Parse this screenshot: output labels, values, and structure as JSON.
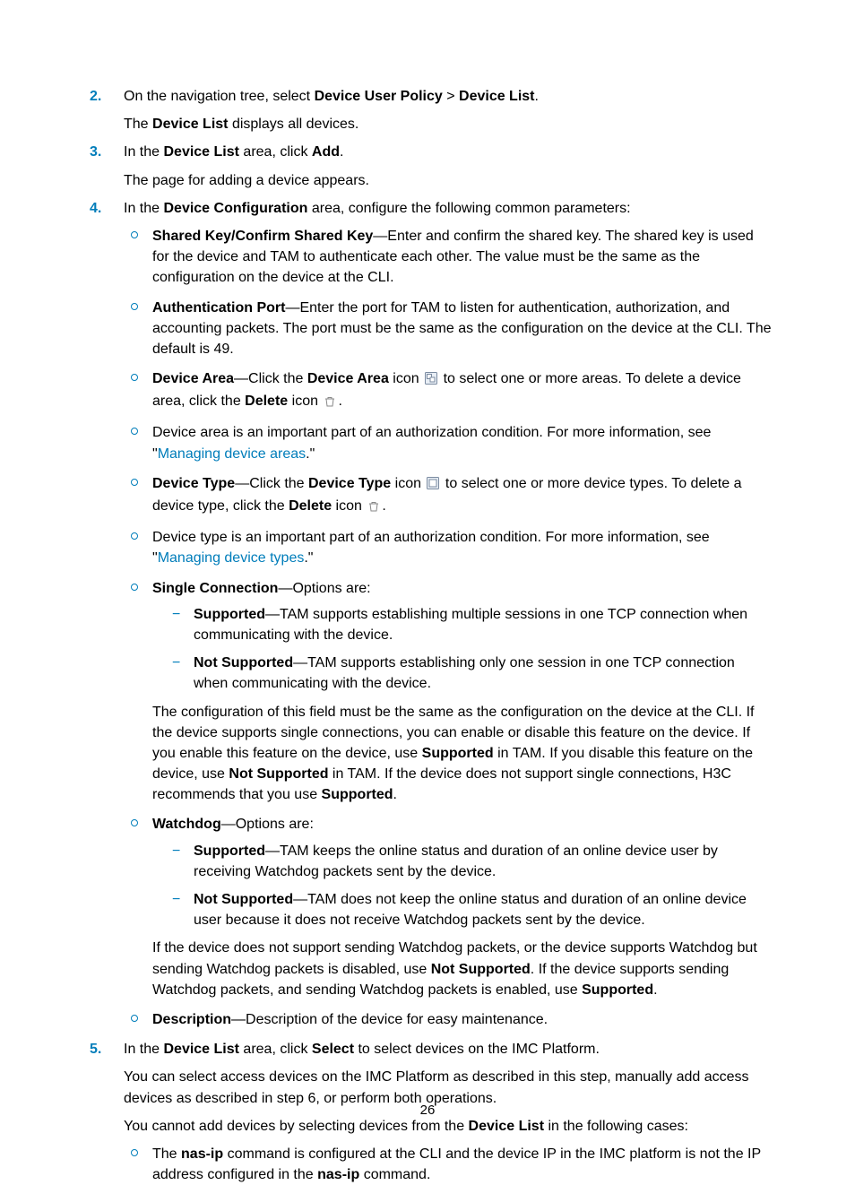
{
  "pageNumber": "26",
  "steps": {
    "s2": {
      "num": "2.",
      "line1_a": "On the navigation tree, select ",
      "line1_b": "Device User Policy",
      "line1_c": " > ",
      "line1_d": "Device List",
      "line1_e": ".",
      "line2_a": "The ",
      "line2_b": "Device List",
      "line2_c": " displays all devices."
    },
    "s3": {
      "num": "3.",
      "line1_a": "In the ",
      "line1_b": "Device List",
      "line1_c": " area, click ",
      "line1_d": "Add",
      "line1_e": ".",
      "line2": "The page for adding a device appears."
    },
    "s4": {
      "num": "4.",
      "intro_a": "In the ",
      "intro_b": "Device Configuration",
      "intro_c": " area, configure the following common parameters:",
      "b_sharedkey": {
        "label": "Shared Key/Confirm Shared Key",
        "rest": "—Enter and confirm the shared key. The shared key is used for the device and TAM to authenticate each other. The value must be the same as the configuration on the device at the CLI."
      },
      "b_authport": {
        "label": "Authentication Port",
        "rest": "—Enter the port for TAM to listen for authentication, authorization, and accounting packets. The port must be the same as the configuration on the device at the CLI. The default is 49."
      },
      "b_devicearea": {
        "label": "Device Area",
        "p1a": "—Click the ",
        "p1b": "Device Area",
        "p1c": " icon ",
        "p2a": " to select one or more areas. To delete a device area, click the ",
        "p2b": "Delete",
        "p2c": " icon ",
        "p2d": "."
      },
      "b_devicearea_note": {
        "pre": "Device area is an important part of an authorization condition. For more information, see \"",
        "link": "Managing device areas",
        "post": ".\""
      },
      "b_devicetype": {
        "label": "Device Type",
        "p1a": "—Click the ",
        "p1b": "Device Type",
        "p1c": " icon ",
        "p2a": " to select one or more device types. To delete a device type, click the ",
        "p2b": "Delete",
        "p2c": " icon ",
        "p2d": "."
      },
      "b_devicetype_note": {
        "pre": "Device type is an important part of an authorization condition. For more information, see \"",
        "link": "Managing device types",
        "post": ".\""
      },
      "b_singleconn": {
        "label": "Single Connection",
        "rest": "—Options are:",
        "d_supported": {
          "label": "Supported",
          "rest": "—TAM supports establishing multiple sessions in one TCP connection when communicating with the device."
        },
        "d_notsupported": {
          "label": "Not Supported",
          "rest": "—TAM supports establishing only one session in one TCP connection when communicating with the device."
        },
        "after_a": "The configuration of this field must be the same as the configuration on the device at the CLI. If the device supports single connections, you can enable or disable this feature on the device. If you enable this feature on the device, use ",
        "after_b": "Supported",
        "after_c": " in TAM. If you disable this feature on the device, use ",
        "after_d": "Not Supported",
        "after_e": " in TAM. If the device does not support single connections, H3C recommends that you use ",
        "after_f": "Supported",
        "after_g": "."
      },
      "b_watchdog": {
        "label": "Watchdog",
        "rest": "—Options are:",
        "d_supported": {
          "label": "Supported",
          "rest": "—TAM keeps the online status and duration of an online device user by receiving Watchdog packets sent by the device."
        },
        "d_notsupported": {
          "label": "Not Supported",
          "rest": "—TAM does not keep the online status and duration of an online device user because it does not receive Watchdog packets sent by the device."
        },
        "after_a": "If the device does not support sending Watchdog packets, or the device supports Watchdog but sending Watchdog packets is disabled, use ",
        "after_b": "Not Supported",
        "after_c": ". If the device supports sending Watchdog packets, and sending Watchdog packets is enabled, use ",
        "after_d": "Supported",
        "after_e": "."
      },
      "b_description": {
        "label": "Description",
        "rest": "—Description of the device for easy maintenance."
      }
    },
    "s5": {
      "num": "5.",
      "line1_a": "In the ",
      "line1_b": "Device List",
      "line1_c": " area, click ",
      "line1_d": "Select",
      "line1_e": " to select devices on the IMC Platform.",
      "line2": "You can select access devices on the IMC Platform as described in this step, manually add access devices as described in step 6, or perform both operations.",
      "line3_a": "You cannot add devices by selecting devices from the ",
      "line3_b": "Device List",
      "line3_c": " in the following cases:",
      "b_nasip": {
        "pre": "The ",
        "b1": "nas-ip",
        "mid": " command is configured at the CLI and the device IP in the IMC platform is not the IP address configured in the ",
        "b2": "nas-ip",
        "post": " command."
      }
    }
  }
}
